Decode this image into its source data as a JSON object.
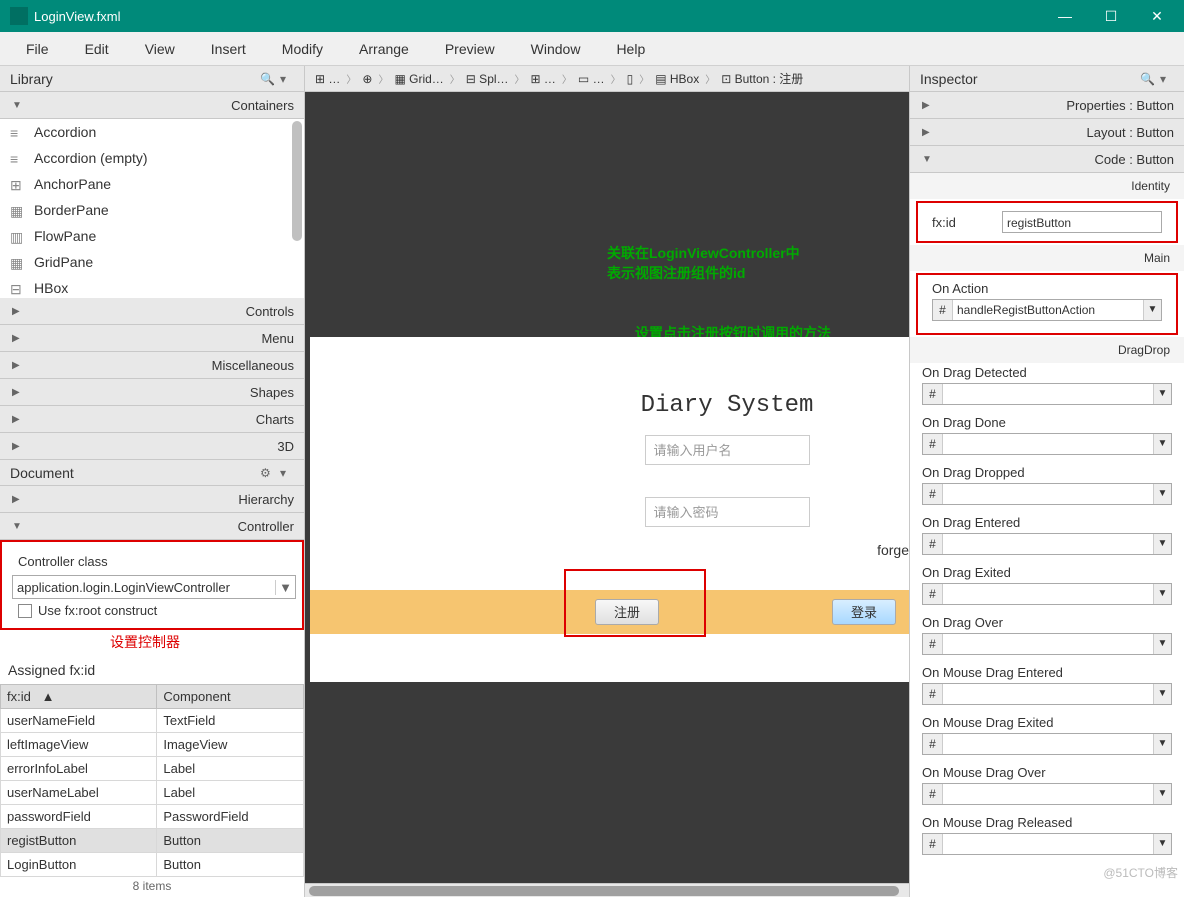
{
  "titlebar": {
    "title": "LoginView.fxml"
  },
  "menu": [
    "File",
    "Edit",
    "View",
    "Insert",
    "Modify",
    "Arrange",
    "Preview",
    "Window",
    "Help"
  ],
  "library": {
    "title": "Library",
    "sections": {
      "containers": "Containers",
      "controls": "Controls",
      "menu": "Menu",
      "misc": "Miscellaneous",
      "shapes": "Shapes",
      "charts": "Charts",
      "threed": "3D"
    },
    "items": [
      "Accordion",
      "Accordion  (empty)",
      "AnchorPane",
      "BorderPane",
      "FlowPane",
      "GridPane",
      "HBox"
    ]
  },
  "document": {
    "title": "Document",
    "hierarchy": "Hierarchy",
    "controller": "Controller",
    "ctrl_class_label": "Controller class",
    "ctrl_class_value": "application.login.LoginViewController",
    "fxroot_label": "Use fx:root construct",
    "set_ctrl_cn": "设置控制器",
    "assigned_label": "Assigned fx:id",
    "table": {
      "cols": [
        "fx:id",
        "Component"
      ],
      "rows": [
        [
          "userNameField",
          "TextField"
        ],
        [
          "leftImageView",
          "ImageView"
        ],
        [
          "errorInfoLabel",
          "Label"
        ],
        [
          "userNameLabel",
          "Label"
        ],
        [
          "passwordField",
          "PasswordField"
        ],
        [
          "registButton",
          "Button"
        ],
        [
          "LoginButton",
          "Button"
        ]
      ],
      "count": "8 items"
    }
  },
  "breadcrumb": [
    "⊞ …",
    "⊕",
    "▦ Grid…",
    "⊟ Spl…",
    "⊞ …",
    "▭ …",
    "▯",
    "▤ HBox",
    "⊡ Button : 注册"
  ],
  "canvas": {
    "annot1": "关联在LoginViewController中\n表示视图注册组件的id",
    "annot2": "设置点击注册按钮时调用的方法",
    "diary_title": "Diary System",
    "username_ph": "请输入用户名",
    "password_ph": "请输入密码",
    "forget": "forge",
    "regist_btn": "注册",
    "login_btn": "登录"
  },
  "inspector": {
    "title": "Inspector",
    "sections": {
      "properties": "Properties : Button",
      "layout": "Layout : Button",
      "code": "Code : Button"
    },
    "identity": "Identity",
    "fxid_label": "fx:id",
    "fxid_value": "registButton",
    "main": "Main",
    "onaction_label": "On Action",
    "onaction_value": "handleRegistButtonAction",
    "dragdrop": "DragDrop",
    "events": [
      "On Drag Detected",
      "On Drag Done",
      "On Drag Dropped",
      "On Drag Entered",
      "On Drag Exited",
      "On Drag Over",
      "On Mouse Drag Entered",
      "On Mouse Drag Exited",
      "On Mouse Drag Over",
      "On Mouse Drag Released"
    ]
  },
  "watermark": "@51CTO博客"
}
